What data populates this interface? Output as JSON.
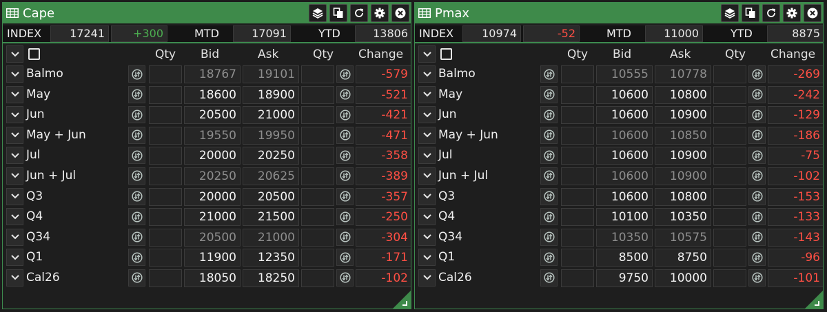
{
  "colors": {
    "header_green": "#3e8a4a",
    "positive": "#4caf50",
    "negative": "#ff4f44",
    "dim_text": "#8d8d8d"
  },
  "icons": {
    "title": "grid-table-icon",
    "toolbar": [
      "layers-icon",
      "copy-icon",
      "refresh-icon",
      "gear-icon",
      "close-icon"
    ],
    "row_toggle": "chevron-down-icon",
    "swap": "swap-arrows-icon",
    "resize": "resize-corner-icon"
  },
  "headers": {
    "qty1": "Qty",
    "bid": "Bid",
    "ask": "Ask",
    "qty2": "Qty",
    "change": "Change"
  },
  "index_labels": {
    "index": "INDEX",
    "mtd": "MTD",
    "ytd": "YTD"
  },
  "panels": [
    {
      "title": "Cape",
      "index_value": "17241",
      "index_change": "+300",
      "index_change_sign": "pos",
      "mtd": "17091",
      "ytd": "13806",
      "rows": [
        {
          "name": "Balmo",
          "bid": "18767",
          "ask": "19101",
          "change": "-579",
          "dim": true
        },
        {
          "name": "May",
          "bid": "18600",
          "ask": "18900",
          "change": "-521",
          "dim": false
        },
        {
          "name": "Jun",
          "bid": "20500",
          "ask": "21000",
          "change": "-421",
          "dim": false
        },
        {
          "name": "May + Jun",
          "bid": "19550",
          "ask": "19950",
          "change": "-471",
          "dim": true
        },
        {
          "name": "Jul",
          "bid": "20000",
          "ask": "20250",
          "change": "-358",
          "dim": false
        },
        {
          "name": "Jun + Jul",
          "bid": "20250",
          "ask": "20625",
          "change": "-389",
          "dim": true
        },
        {
          "name": "Q3",
          "bid": "20000",
          "ask": "20500",
          "change": "-357",
          "dim": false
        },
        {
          "name": "Q4",
          "bid": "21000",
          "ask": "21500",
          "change": "-250",
          "dim": false
        },
        {
          "name": "Q34",
          "bid": "20500",
          "ask": "21000",
          "change": "-304",
          "dim": true
        },
        {
          "name": "Q1",
          "bid": "11900",
          "ask": "12350",
          "change": "-171",
          "dim": false
        },
        {
          "name": "Cal26",
          "bid": "18050",
          "ask": "18250",
          "change": "-102",
          "dim": false
        }
      ]
    },
    {
      "title": "Pmax",
      "index_value": "10974",
      "index_change": "-52",
      "index_change_sign": "neg",
      "mtd": "11000",
      "ytd": "8875",
      "rows": [
        {
          "name": "Balmo",
          "bid": "10555",
          "ask": "10778",
          "change": "-269",
          "dim": true
        },
        {
          "name": "May",
          "bid": "10600",
          "ask": "10800",
          "change": "-242",
          "dim": false
        },
        {
          "name": "Jun",
          "bid": "10600",
          "ask": "10900",
          "change": "-129",
          "dim": false
        },
        {
          "name": "May + Jun",
          "bid": "10600",
          "ask": "10850",
          "change": "-186",
          "dim": true
        },
        {
          "name": "Jul",
          "bid": "10600",
          "ask": "10900",
          "change": "-75",
          "dim": false
        },
        {
          "name": "Jun + Jul",
          "bid": "10600",
          "ask": "10900",
          "change": "-102",
          "dim": true
        },
        {
          "name": "Q3",
          "bid": "10600",
          "ask": "10800",
          "change": "-153",
          "dim": false
        },
        {
          "name": "Q4",
          "bid": "10100",
          "ask": "10350",
          "change": "-133",
          "dim": false
        },
        {
          "name": "Q34",
          "bid": "10350",
          "ask": "10575",
          "change": "-143",
          "dim": true
        },
        {
          "name": "Q1",
          "bid": "8500",
          "ask": "8750",
          "change": "-96",
          "dim": false
        },
        {
          "name": "Cal26",
          "bid": "9750",
          "ask": "10000",
          "change": "-101",
          "dim": false
        }
      ]
    }
  ]
}
